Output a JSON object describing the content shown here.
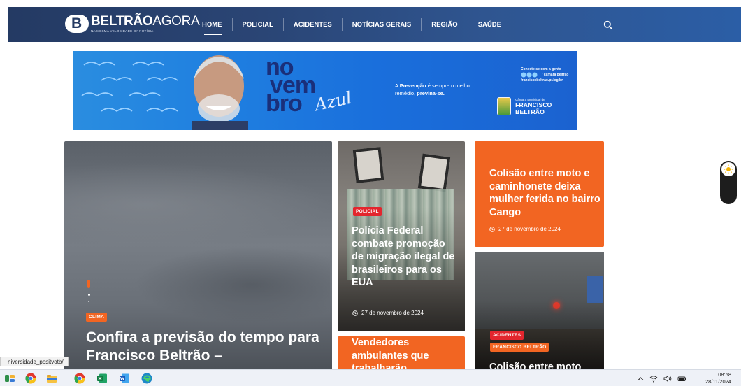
{
  "site": {
    "logo_bold": "BELTRÃO",
    "logo_light": "AGORA",
    "logo_tagline": "NA MESMA VELOCIDADE DA NOTÍCIA"
  },
  "nav": {
    "items": [
      {
        "label": "HOME",
        "active": true
      },
      {
        "label": "POLICIAL"
      },
      {
        "label": "ACIDENTES"
      },
      {
        "label": "NOTÍCIAS GERAIS"
      },
      {
        "label": "REGIÃO"
      },
      {
        "label": "SAÚDE"
      }
    ]
  },
  "banner": {
    "line1": "no",
    "line2": "vem",
    "line3": "bro",
    "script": "Azul",
    "text_pre": "A ",
    "text_bold1": "Prevenção",
    "text_mid": " é sempre o melhor remédio, ",
    "text_bold2": "previna-se.",
    "connect": "Conecte-se com a gente",
    "handle": "/ camara beltrao",
    "site": "franciscobeltrao.pr.leg.br",
    "camara_small": "Câmara Municipal de",
    "camara_big": "FRANCISCO BELTRÃO"
  },
  "articles": {
    "hero": {
      "category": "CLIMA",
      "title": "Confira a previsão do tempo para Francisco Beltrão –"
    },
    "policial": {
      "category": "POLICIAL",
      "title": "Polícia Federal combate promoção de migração ilegal de brasileiros para os EUA",
      "date": "27 de novembro de 2024"
    },
    "colisao": {
      "title": "Colisão entre moto e caminhonete deixa mulher ferida no bairro Cango",
      "date": "27 de novembro de 2024"
    },
    "vendedores": {
      "title": "Vendedores ambulantes que trabalharão"
    },
    "acidentes": {
      "category1": "ACIDENTES",
      "category2": "FRANCISCO BELTRÃO",
      "title": "Colisão entre moto"
    }
  },
  "status_url": "niversidade_positvotb/",
  "taskbar": {
    "time": "08:58",
    "date": "28/11/2024"
  },
  "colors": {
    "accent_orange": "#f26522",
    "badge_red": "#e3262e",
    "nav_dark": "#243a63",
    "nav_light": "#2b5ea6"
  }
}
